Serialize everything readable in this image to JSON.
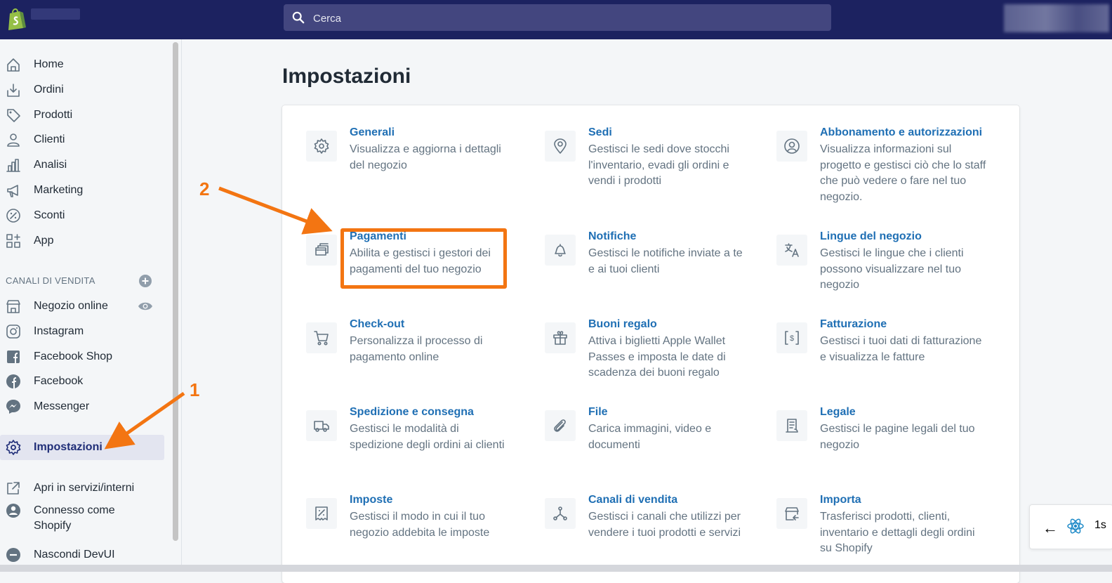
{
  "search": {
    "placeholder": "Cerca"
  },
  "sidebar": {
    "items": [
      {
        "label": "Home",
        "icon": "home-icon"
      },
      {
        "label": "Ordini",
        "icon": "orders-icon"
      },
      {
        "label": "Prodotti",
        "icon": "tag-icon"
      },
      {
        "label": "Clienti",
        "icon": "person-icon"
      },
      {
        "label": "Analisi",
        "icon": "bar-chart-icon"
      },
      {
        "label": "Marketing",
        "icon": "megaphone-icon"
      },
      {
        "label": "Sconti",
        "icon": "discount-icon"
      },
      {
        "label": "App",
        "icon": "apps-icon"
      }
    ],
    "sales_channels_title": "CANALI DI VENDITA",
    "channels": [
      {
        "label": "Negozio online",
        "icon": "store-icon"
      },
      {
        "label": "Instagram",
        "icon": "instagram-icon"
      },
      {
        "label": "Facebook Shop",
        "icon": "facebook-square-icon"
      },
      {
        "label": "Facebook",
        "icon": "facebook-circle-icon"
      },
      {
        "label": "Messenger",
        "icon": "messenger-icon"
      }
    ],
    "settings_label": "Impostazioni",
    "footer": [
      {
        "label": "Apri in servizi/interni",
        "icon": "external-link-icon"
      },
      {
        "label": "Connesso come\nShopify",
        "icon": "user-circle-icon"
      },
      {
        "label": "Nascondi DevUI",
        "icon": "minus-circle-icon"
      }
    ]
  },
  "main": {
    "title": "Impostazioni",
    "settings": [
      {
        "title": "Generali",
        "desc": "Visualizza e aggiorna i dettagli del negozio",
        "icon": "gear-icon"
      },
      {
        "title": "Sedi",
        "desc": "Gestisci le sedi dove stocchi l'inventario, evadi gli ordini e vendi i prodotti",
        "icon": "location-icon"
      },
      {
        "title": "Abbonamento e autorizzazioni",
        "desc": "Visualizza informazioni sul progetto e gestisci ciò che lo staff che può vedere o fare nel tuo negozio.",
        "icon": "account-icon"
      },
      {
        "title": "Pagamenti",
        "desc": "Abilita e gestisci i gestori dei pagamenti del tuo negozio",
        "icon": "payments-icon"
      },
      {
        "title": "Notifiche",
        "desc": "Gestisci le notifiche inviate a te e ai tuoi clienti",
        "icon": "bell-icon"
      },
      {
        "title": "Lingue del negozio",
        "desc": "Gestisci le lingue che i clienti possono visualizzare nel tuo negozio",
        "icon": "translate-icon"
      },
      {
        "title": "Check-out",
        "desc": "Personalizza il processo di pagamento online",
        "icon": "cart-icon"
      },
      {
        "title": "Buoni regalo",
        "desc": "Attiva i biglietti Apple Wallet Passes e imposta le date di scadenza dei buoni regalo",
        "icon": "gift-icon"
      },
      {
        "title": "Fatturazione",
        "desc": "Gestisci i tuoi dati di fatturazione e visualizza le fatture",
        "icon": "billing-icon"
      },
      {
        "title": "Spedizione e consegna",
        "desc": "Gestisci le modalità di spedizione degli ordini ai clienti",
        "icon": "truck-icon"
      },
      {
        "title": "File",
        "desc": "Carica immagini, video e documenti",
        "icon": "paperclip-icon"
      },
      {
        "title": "Legale",
        "desc": "Gestisci le pagine legali del tuo negozio",
        "icon": "legal-icon"
      },
      {
        "title": "Imposte",
        "desc": "Gestisci il modo in cui il tuo negozio addebita le imposte",
        "icon": "tax-icon"
      },
      {
        "title": "Canali di vendita",
        "desc": "Gestisci i canali che utilizzi per vendere i tuoi prodotti e servizi",
        "icon": "channels-icon"
      },
      {
        "title": "Importa",
        "desc": "Trasferisci prodotti, clienti, inventario e dettagli degli ordini su Shopify",
        "icon": "import-icon"
      }
    ]
  },
  "annotations": {
    "step1": "1",
    "step2": "2",
    "color": "#f37512"
  },
  "devtools": {
    "back_label": "←",
    "time": "1s"
  },
  "colors": {
    "topbar": "#1c2260",
    "link": "#1f6fb4",
    "active_nav": "#202e78"
  }
}
